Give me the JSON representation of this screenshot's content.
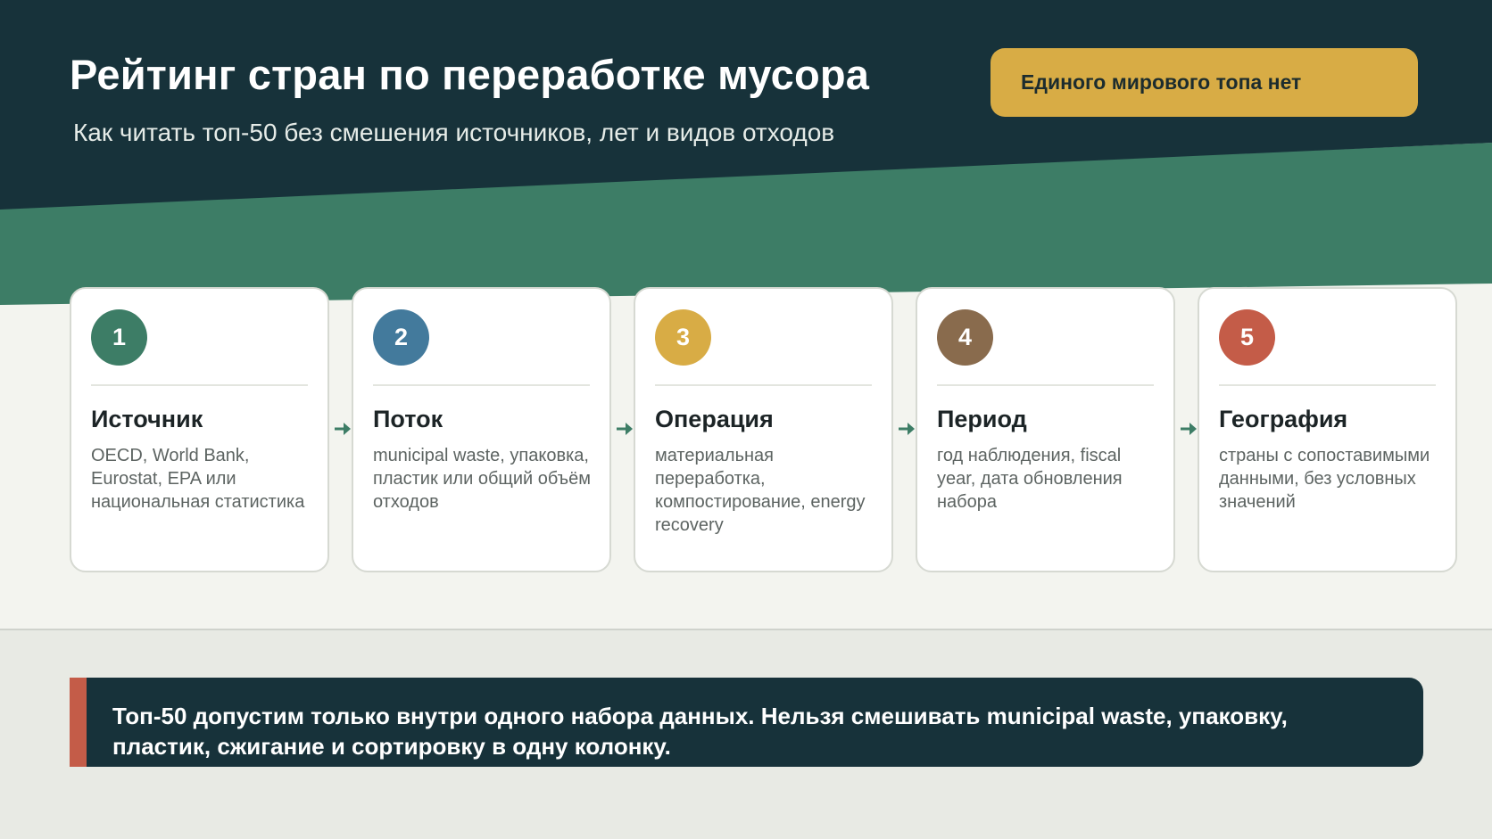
{
  "header": {
    "title": "Рейтинг стран по переработке мусора",
    "subtitle": "Как читать топ-50 без смешения источников, лет и видов отходов",
    "badge": "Единого мирового топа нет"
  },
  "colors": {
    "header_dark": "#17323a",
    "accent_green": "#3d7d66",
    "badge_gold": "#d8ac45",
    "note_accent": "#c45c48"
  },
  "steps": [
    {
      "number": "1",
      "title": "Источник",
      "description": "OECD, World Bank, Eurostat, EPA или национальная статистика",
      "color": "#3d7d66"
    },
    {
      "number": "2",
      "title": "Поток",
      "description": "municipal waste, упаковка, пластик или общий объём отходов",
      "color": "#437a9c"
    },
    {
      "number": "3",
      "title": "Операция",
      "description": "материальная переработка, компостирование, energy recovery",
      "color": "#d8ac45"
    },
    {
      "number": "4",
      "title": "Период",
      "description": "год наблюдения, fiscal year, дата обновления набора",
      "color": "#896b4d"
    },
    {
      "number": "5",
      "title": "География",
      "description": "страны с сопоставимыми данными, без условных значений",
      "color": "#c45c48"
    }
  ],
  "note": {
    "text": "Топ-50 допустим только внутри одного набора данных. Нельзя смешивать municipal waste, упаковку, пластик, сжигание и сортировку в одну колонку."
  }
}
